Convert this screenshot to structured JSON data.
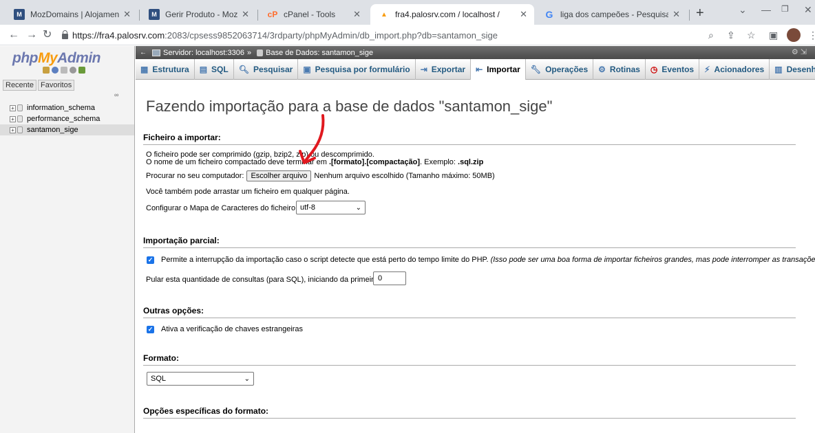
{
  "browser": {
    "tabs": [
      {
        "title": "MozDomains | Alojamento de",
        "icon": "mozdomains-icon",
        "close": "✕"
      },
      {
        "title": "Gerir Produto - MozDomains",
        "icon": "mozdomains-icon",
        "close": "✕"
      },
      {
        "title": "cPanel - Tools",
        "icon": "cpanel-icon",
        "close": "✕"
      },
      {
        "title": "fra4.palosrv.com / localhost /",
        "icon": "phpmyadmin-icon",
        "close": "✕"
      },
      {
        "title": "liga dos campeões - Pesquisa",
        "icon": "google-icon",
        "close": "✕"
      }
    ],
    "new_tab": "+",
    "url_host": "https://fra4.palosrv.com",
    "url_path": ":2083/cpsess9852063714/3rdparty/phpMyAdmin/db_import.php?db=santamon_sige"
  },
  "sidebar": {
    "logo": {
      "php": "php",
      "my": "My",
      "admin": "Admin"
    },
    "recent": "Recente",
    "favorites": "Favoritos",
    "databases": [
      "information_schema",
      "performance_schema",
      "santamon_sige"
    ],
    "selected_database": "santamon_sige"
  },
  "breadcrumb": {
    "server": "Servidor: localhost:3306",
    "separator": "»",
    "database": "Base de Dados: santamon_sige"
  },
  "menu": {
    "tabs": [
      {
        "label": "Estrutura",
        "icon": "structure-icon"
      },
      {
        "label": "SQL",
        "icon": "sql-icon"
      },
      {
        "label": "Pesquisar",
        "icon": "search-icon"
      },
      {
        "label": "Pesquisa por formulário",
        "icon": "query-icon"
      },
      {
        "label": "Exportar",
        "icon": "export-icon"
      },
      {
        "label": "Importar",
        "icon": "import-icon"
      },
      {
        "label": "Operações",
        "icon": "wrench-icon"
      },
      {
        "label": "Rotinas",
        "icon": "routines-icon"
      },
      {
        "label": "Eventos",
        "icon": "clock-icon"
      },
      {
        "label": "Acionadores",
        "icon": "triggers-icon"
      },
      {
        "label": "Desenhador",
        "icon": "designer-icon"
      }
    ],
    "active": "Importar"
  },
  "page": {
    "title": "Fazendo importação para a base de dados \"santamon_sige\"",
    "file_section": {
      "heading": "Ficheiro a importar:",
      "line1": "O ficheiro pode ser comprimido (gzip, bzip2, zip) ou descomprimido.",
      "line2_prefix": "O nome de um ficheiro compactado deve terminar em ",
      "line2_format": ".[formato].[compactação]",
      "line2_mid": ". Exemplo: ",
      "line2_example": ".sql.zip",
      "browse_label": "Procurar no seu computador:",
      "browse_button": "Escolher arquivo",
      "no_file": "Nenhum arquivo escolhido",
      "max_size": "(Tamanho máximo: 50MB)",
      "drag_hint": "Você também pode arrastar um ficheiro em qualquer página.",
      "charset_label": "Configurar o Mapa de Caracteres do ficheiro:",
      "charset_value": "utf-8"
    },
    "partial_section": {
      "heading": "Importação parcial:",
      "allow_interrupt": "Permite a interrupção da importação caso o script detecte que está perto do tempo limite do PHP.",
      "allow_interrupt_note": "(Isso pode ser uma boa forma de importar ficheiros grandes, mas pode interromper as transações.)",
      "allow_interrupt_checked": true,
      "skip_label": "Pular esta quantidade de consultas (para SQL), iniciando da primeira:",
      "skip_value": "0"
    },
    "other_section": {
      "heading": "Outras opções:",
      "fk_checks": "Ativa a verificação de chaves estrangeiras",
      "fk_checks_checked": true
    },
    "format_section": {
      "heading": "Formato:",
      "format_value": "SQL"
    },
    "format_options_section": {
      "heading": "Opções específicas do formato:"
    }
  },
  "colors": {
    "pma_blue": "#6c78af",
    "pma_orange": "#f89c0e",
    "annotation_arrow": "#e0191f",
    "checkbox": "#1a73e8"
  }
}
